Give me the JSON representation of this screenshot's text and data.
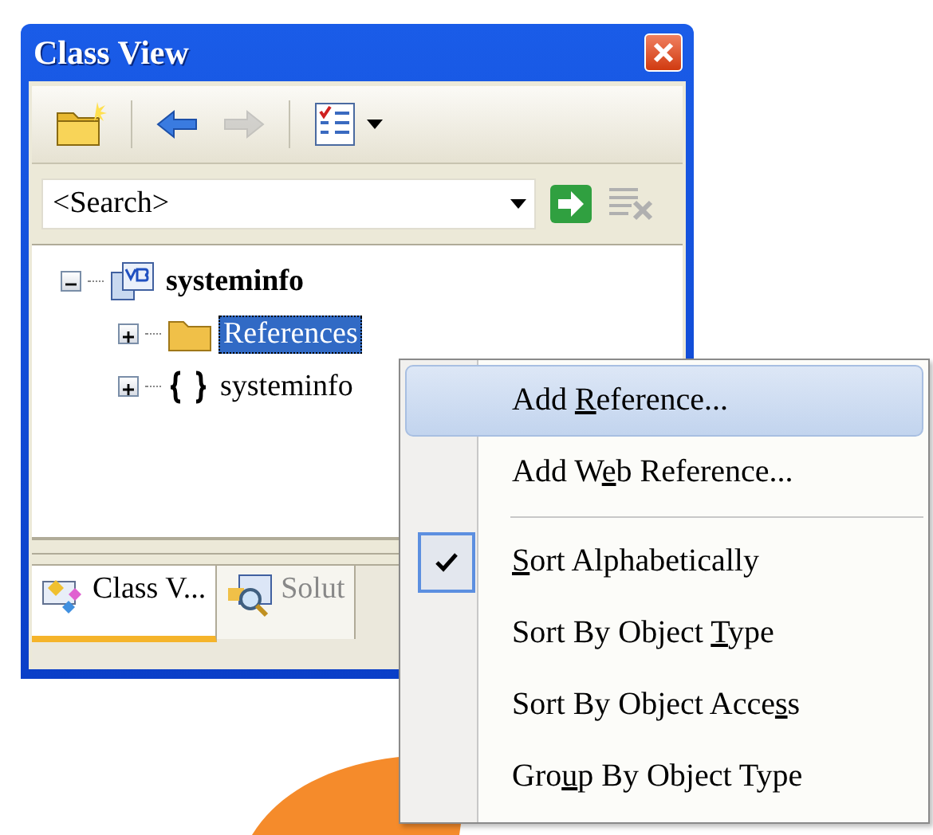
{
  "window": {
    "title": "Class View"
  },
  "toolbar": [
    {
      "kind": "new-folder",
      "disabled": false
    },
    {
      "kind": "separator"
    },
    {
      "kind": "back",
      "disabled": false
    },
    {
      "kind": "forward",
      "disabled": true
    },
    {
      "kind": "separator"
    },
    {
      "kind": "view-settings",
      "disabled": false
    }
  ],
  "search": {
    "placeholder": "<Search>",
    "go_disabled": false,
    "clear_disabled": true
  },
  "tree": {
    "items": [
      {
        "label": "systeminfo",
        "kind": "project",
        "expanded": true,
        "selected": false,
        "children": [
          {
            "label": "References",
            "kind": "folder",
            "expanded": false,
            "selected": true
          },
          {
            "label": "systeminfo",
            "kind": "namespace",
            "expanded": false,
            "selected": false
          }
        ]
      }
    ]
  },
  "tabs": [
    {
      "label": "Class V...",
      "kind": "class-view",
      "selected": true
    },
    {
      "label": "Solut",
      "kind": "solution",
      "selected": false
    }
  ],
  "menu": {
    "items": [
      {
        "kind": "item",
        "pre": "Add ",
        "key": "R",
        "post": "eference...",
        "selected": true,
        "checked": false
      },
      {
        "kind": "item",
        "pre": "Add W",
        "key": "e",
        "post": "b Reference...",
        "selected": false,
        "checked": false
      },
      {
        "kind": "separator"
      },
      {
        "kind": "item",
        "key": "S",
        "post": "ort Alphabetically",
        "selected": false,
        "checked": true
      },
      {
        "kind": "item",
        "pre": "Sort By Object ",
        "key": "T",
        "post": "ype",
        "selected": false,
        "checked": false
      },
      {
        "kind": "item",
        "pre": "Sort By Object Acce",
        "key": "s",
        "post": "s",
        "selected": false,
        "checked": false
      },
      {
        "kind": "item",
        "pre": "Gro",
        "key": "u",
        "post": "p By Object Type",
        "selected": false,
        "checked": false
      }
    ]
  }
}
